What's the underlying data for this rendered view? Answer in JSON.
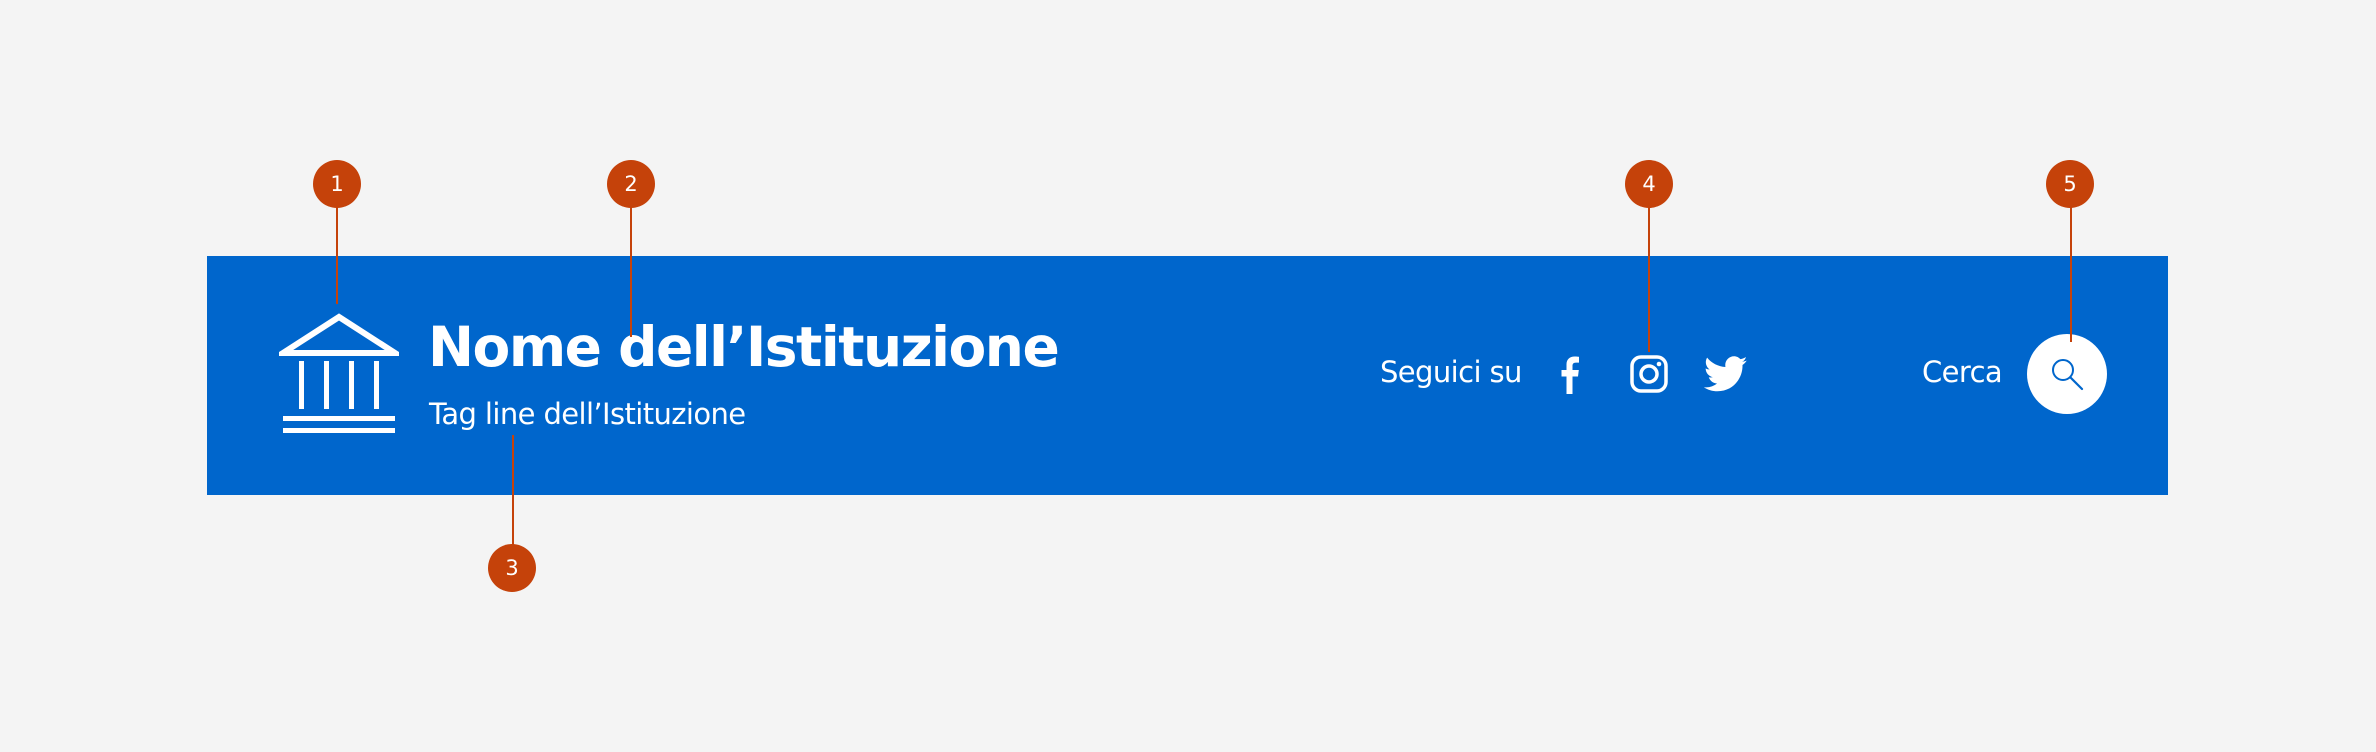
{
  "header": {
    "background_color": "#0066cc",
    "brand": {
      "logo_icon": "institution-building-icon",
      "title": "Nome dell’Istituzione",
      "tagline": "Tag line dell’Istituzione"
    },
    "social": {
      "label": "Seguici su",
      "links": [
        {
          "icon": "facebook-icon"
        },
        {
          "icon": "instagram-icon"
        },
        {
          "icon": "twitter-icon"
        }
      ]
    },
    "search": {
      "label": "Cerca",
      "icon": "search-icon"
    }
  },
  "callouts": {
    "color": "#c5420a",
    "markers": [
      {
        "number": "1"
      },
      {
        "number": "2"
      },
      {
        "number": "3"
      },
      {
        "number": "4"
      },
      {
        "number": "5"
      }
    ]
  }
}
